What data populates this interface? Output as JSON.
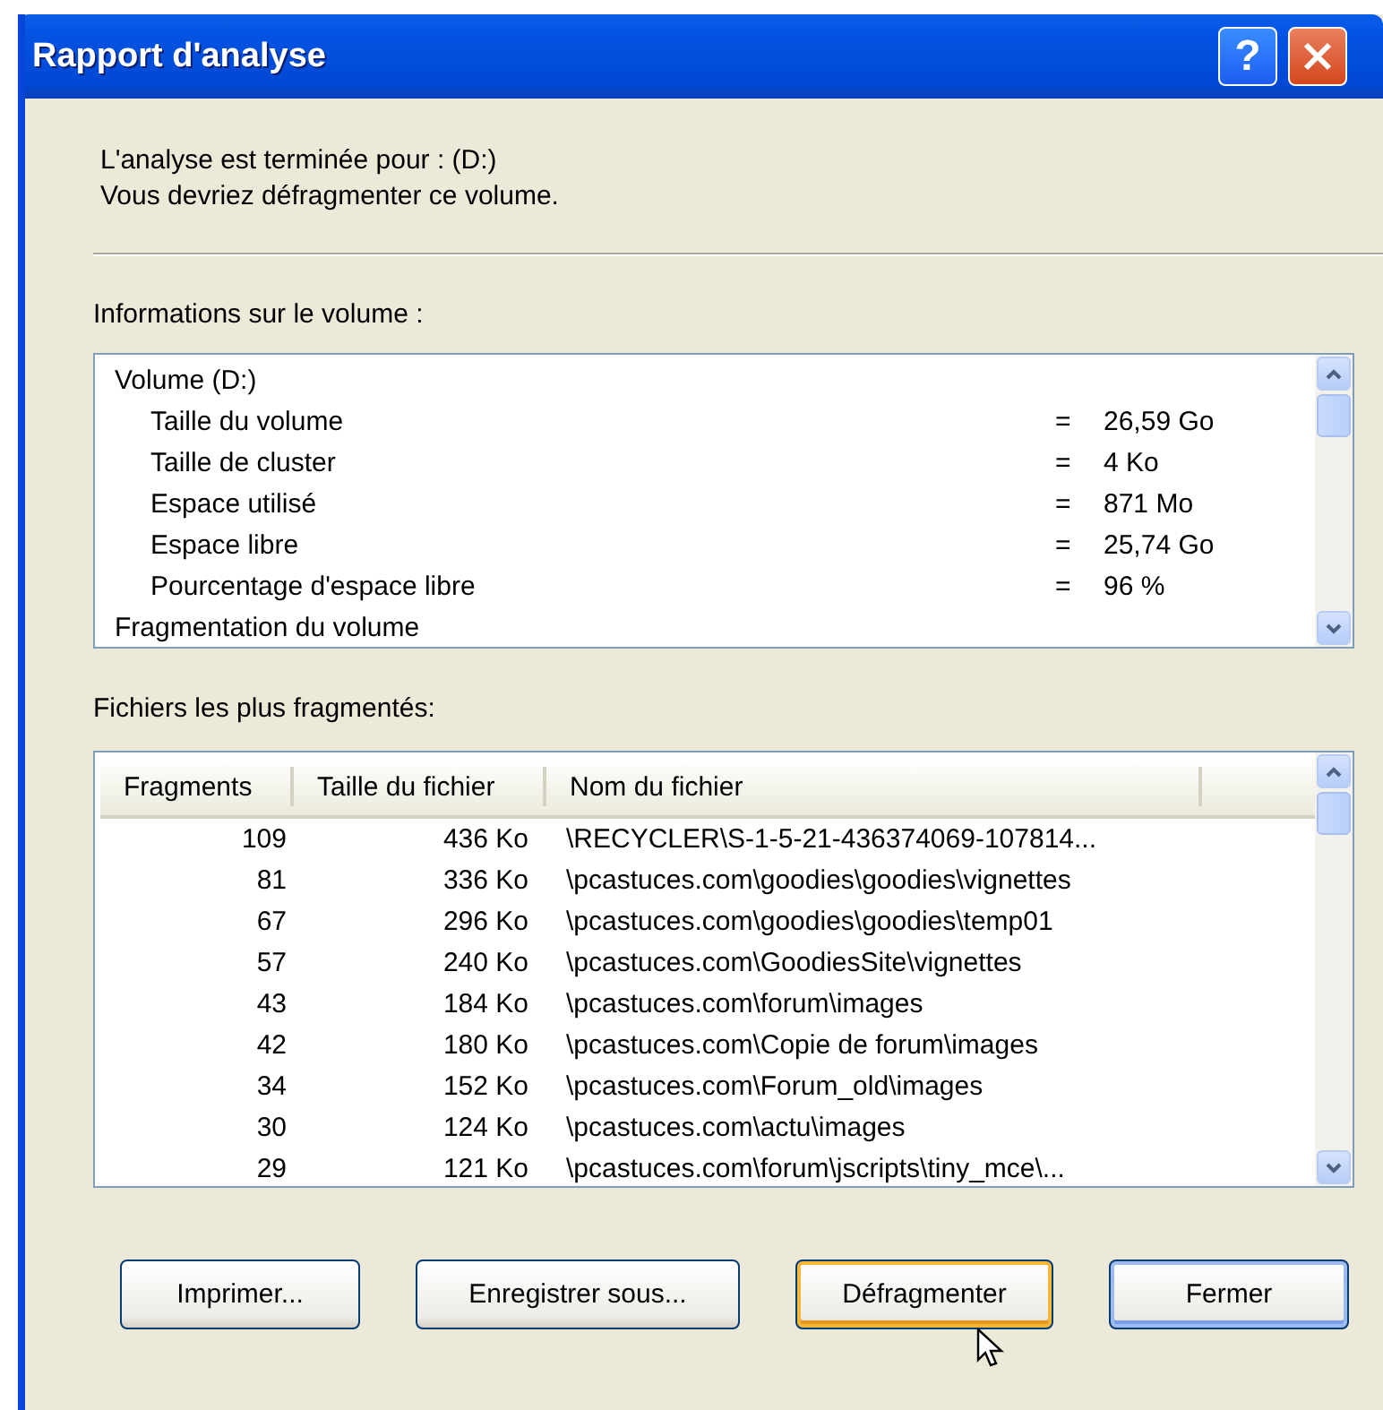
{
  "window": {
    "title": "Rapport d'analyse",
    "help_label": "?"
  },
  "message": [
    "L'analyse est terminée pour : (D:)",
    "Vous devriez défragmenter ce volume."
  ],
  "volume_info": {
    "label": "Informations sur le volume :",
    "rows": [
      {
        "kind": "group",
        "name": "Volume  (D:)"
      },
      {
        "kind": "item",
        "name": "Taille du volume",
        "equals": "=",
        "value": "26,59 Go"
      },
      {
        "kind": "item",
        "name": "Taille de cluster",
        "equals": "=",
        "value": "4 Ko"
      },
      {
        "kind": "item",
        "name": "Espace utilisé",
        "equals": "=",
        "value": "871 Mo"
      },
      {
        "kind": "item",
        "name": "Espace libre",
        "equals": "=",
        "value": "25,74 Go"
      },
      {
        "kind": "item",
        "name": "Pourcentage d'espace libre",
        "equals": "=",
        "value": "96 %"
      },
      {
        "kind": "group",
        "name": "Fragmentation du volume"
      }
    ]
  },
  "fragmented_files": {
    "label": "Fichiers les plus fragmentés:",
    "columns": [
      "Fragments",
      "Taille du fichier",
      "Nom du fichier"
    ],
    "rows": [
      [
        "109",
        "436 Ko",
        "\\RECYCLER\\S-1-5-21-436374069-107814..."
      ],
      [
        "81",
        "336 Ko",
        "\\pcastuces.com\\goodies\\goodies\\vignettes"
      ],
      [
        "67",
        "296 Ko",
        "\\pcastuces.com\\goodies\\goodies\\temp01"
      ],
      [
        "57",
        "240 Ko",
        "\\pcastuces.com\\GoodiesSite\\vignettes"
      ],
      [
        "43",
        "184 Ko",
        "\\pcastuces.com\\forum\\images"
      ],
      [
        "42",
        "180 Ko",
        "\\pcastuces.com\\Copie de forum\\images"
      ],
      [
        "34",
        "152 Ko",
        "\\pcastuces.com\\Forum_old\\images"
      ],
      [
        "30",
        "124 Ko",
        "\\pcastuces.com\\actu\\images"
      ],
      [
        "29",
        "121 Ko",
        "\\pcastuces.com\\forum\\jscripts\\tiny_mce\\..."
      ]
    ]
  },
  "buttons": [
    {
      "label": "Imprimer...",
      "kind": "normal"
    },
    {
      "label": "Enregistrer sous...",
      "kind": "normal"
    },
    {
      "label": "Défragmenter",
      "kind": "hot"
    },
    {
      "label": "Fermer",
      "kind": "default"
    }
  ]
}
